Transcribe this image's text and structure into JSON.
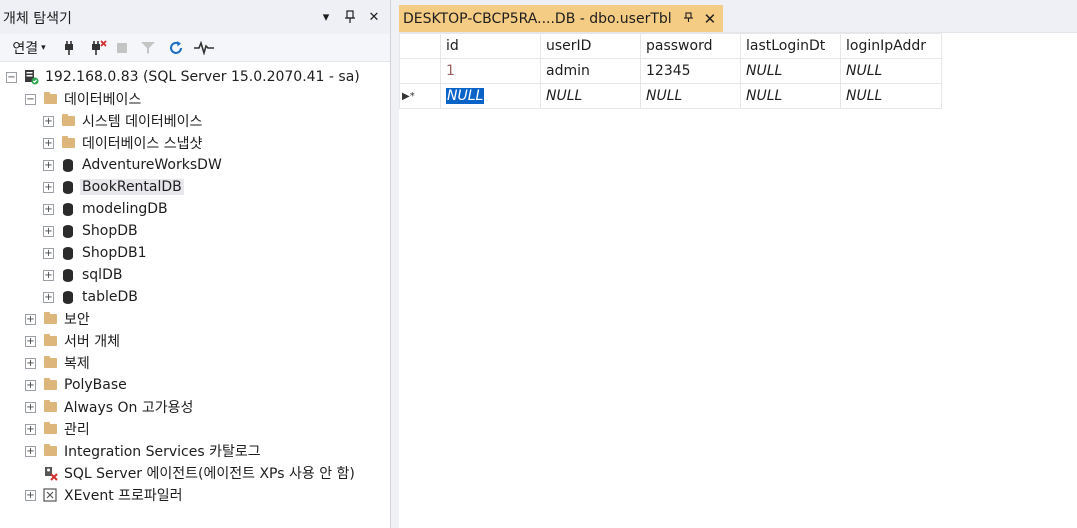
{
  "object_explorer": {
    "title": "개체 탐색기",
    "controls": {
      "dropdown": "▾",
      "pin": "⊿",
      "close": "✕"
    },
    "toolbar": {
      "connect_label": "연결",
      "connect_caret": "▾"
    },
    "server": {
      "label": "192.168.0.83 (SQL Server 15.0.2070.41 - sa)"
    },
    "databases_folder": {
      "label": "데이터베이스"
    },
    "db_children": [
      {
        "label": "시스템 데이터베이스",
        "icon": "folder"
      },
      {
        "label": "데이터베이스 스냅샷",
        "icon": "folder"
      },
      {
        "label": "AdventureWorksDW",
        "icon": "database"
      },
      {
        "label": "BookRentalDB",
        "icon": "database",
        "selected": true
      },
      {
        "label": "modelingDB",
        "icon": "database"
      },
      {
        "label": "ShopDB",
        "icon": "database"
      },
      {
        "label": "ShopDB1",
        "icon": "database"
      },
      {
        "label": "sqlDB",
        "icon": "database"
      },
      {
        "label": "tableDB",
        "icon": "database"
      }
    ],
    "server_children": [
      {
        "label": "보안",
        "icon": "folder"
      },
      {
        "label": "서버 개체",
        "icon": "folder"
      },
      {
        "label": "복제",
        "icon": "folder"
      },
      {
        "label": "PolyBase",
        "icon": "folder"
      },
      {
        "label": "Always On 고가용성",
        "icon": "folder"
      },
      {
        "label": "관리",
        "icon": "folder"
      },
      {
        "label": "Integration Services 카탈로그",
        "icon": "folder"
      }
    ],
    "agent": {
      "label": "SQL Server 에이전트(에이전트 XPs 사용 안 함)"
    },
    "xevent": {
      "label": "XEvent 프로파일러"
    },
    "expander": {
      "plus": "+",
      "minus": "−"
    }
  },
  "editor": {
    "tab": {
      "title": "DESKTOP-CBCP5RA....DB - dbo.userTbl",
      "pin": "⊿",
      "close": "✕"
    },
    "grid": {
      "columns": [
        "id",
        "userID",
        "password",
        "lastLoginDt",
        "loginIpAddr"
      ],
      "rows": [
        {
          "marker": "",
          "cells": [
            "1",
            "admin",
            "12345",
            "NULL",
            "NULL"
          ]
        },
        {
          "marker": "▶*",
          "cells": [
            "NULL",
            "NULL",
            "NULL",
            "NULL",
            "NULL"
          ]
        }
      ]
    }
  },
  "colors": {
    "tab_active": "#f5cc84",
    "folder": "#dcb67a",
    "selection": "#0a64c8"
  }
}
